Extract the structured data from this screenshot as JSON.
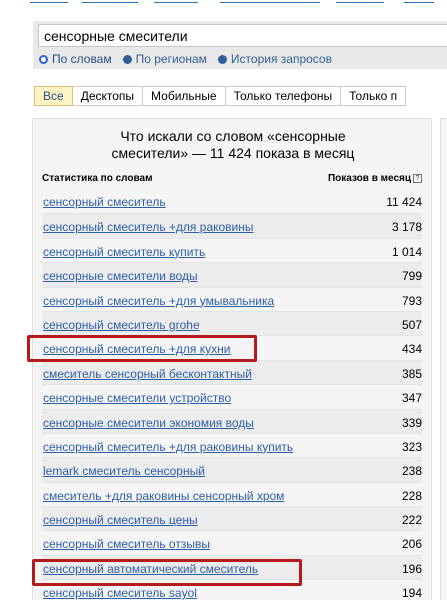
{
  "search": {
    "query": "сенсорные смесители",
    "modes": [
      {
        "label": "По словам",
        "selected": true
      },
      {
        "label": "По регионам",
        "selected": false
      },
      {
        "label": "История запросов",
        "selected": false
      }
    ]
  },
  "tabs": [
    {
      "label": "Все",
      "active": true
    },
    {
      "label": "Десктопы",
      "active": false
    },
    {
      "label": "Мобильные",
      "active": false
    },
    {
      "label": "Только телефоны",
      "active": false
    },
    {
      "label": "Только п",
      "active": false
    }
  ],
  "panel": {
    "title_line1": "Что искали со словом «сенсорные",
    "title_line2": "смесители» — 11 424 показа в месяц",
    "col_keyword": "Статистика по словам",
    "col_impressions": "Показов в месяц",
    "help_icon": "?"
  },
  "rows": [
    {
      "keyword": "сенсорный смеситель",
      "count": "11 424"
    },
    {
      "keyword": "сенсорный смеситель +для раковины",
      "count": "3 178"
    },
    {
      "keyword": "сенсорный смеситель купить",
      "count": "1 014"
    },
    {
      "keyword": "сенсорные смесители воды",
      "count": "799"
    },
    {
      "keyword": "сенсорный смеситель +для умывальника",
      "count": "793"
    },
    {
      "keyword": "сенсорный смеситель grohe",
      "count": "507"
    },
    {
      "keyword": "сенсорный смеситель +для кухни",
      "count": "434",
      "highlighted": true
    },
    {
      "keyword": "смеситель сенсорный бесконтактный",
      "count": "385"
    },
    {
      "keyword": "сенсорные смесители устройство",
      "count": "347"
    },
    {
      "keyword": "сенсорные смесители экономия воды",
      "count": "339"
    },
    {
      "keyword": "сенсорный смеситель +для раковины купить",
      "count": "323"
    },
    {
      "keyword": "lemark смеситель сенсорный",
      "count": "238"
    },
    {
      "keyword": "смеситель +для раковины сенсорный хром",
      "count": "228"
    },
    {
      "keyword": "сенсорный смеситель цены",
      "count": "222"
    },
    {
      "keyword": "сенсорный смеситель отзывы",
      "count": "206"
    },
    {
      "keyword": "сенсорный автоматический смеситель",
      "count": "196",
      "highlighted": true
    },
    {
      "keyword": "сенсорный смеситель sayol",
      "count": "194"
    }
  ],
  "colors": {
    "link": "#2b5fa8",
    "highlight_border": "#b41a1a",
    "active_tab_bg": "#fff3c4"
  }
}
